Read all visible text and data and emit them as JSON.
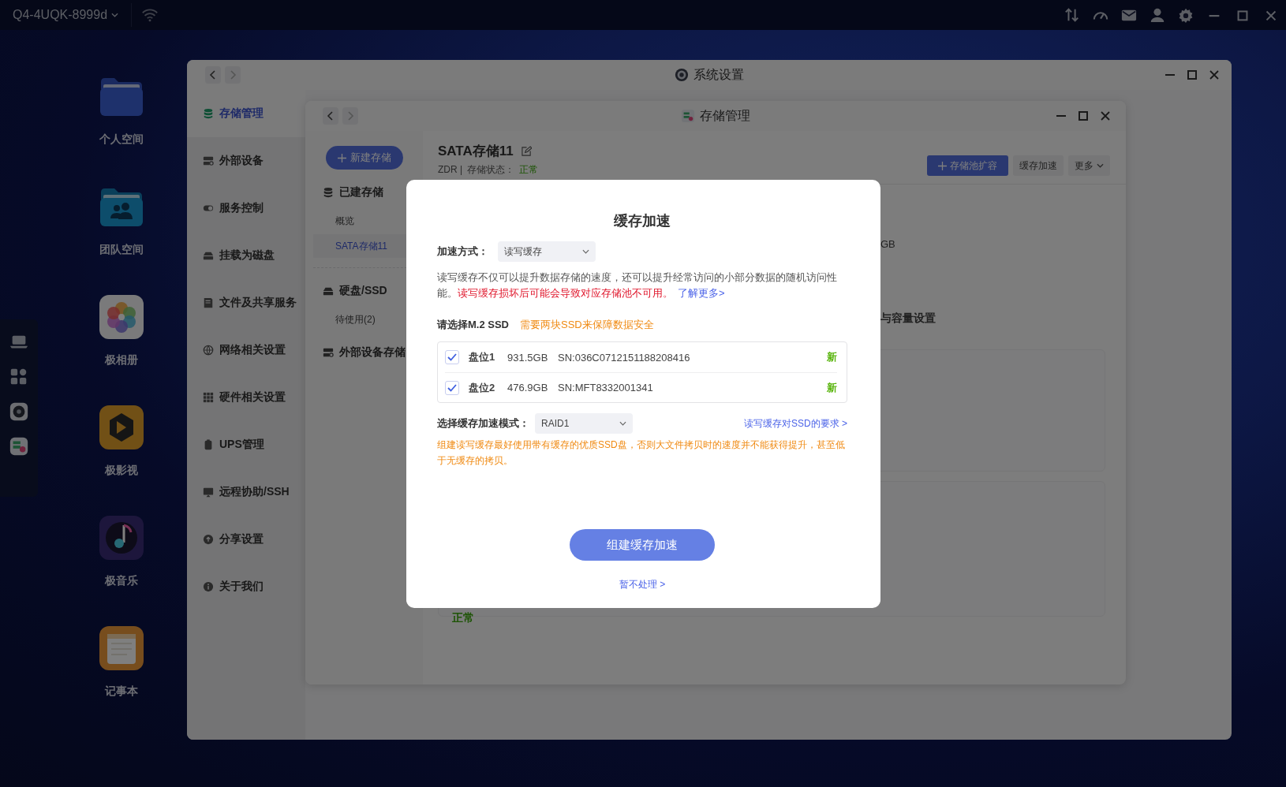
{
  "top_bar": {
    "device_name": "Q4-4UQK-8999d"
  },
  "desktop_icons": [
    {
      "label": "个人空间"
    },
    {
      "label": "团队空间"
    },
    {
      "label": "极相册"
    },
    {
      "label": "极影视"
    },
    {
      "label": "极音乐"
    },
    {
      "label": "记事本"
    }
  ],
  "settings_window": {
    "title": "系统设置",
    "sidebar": [
      {
        "label": "存储管理",
        "selected": true
      },
      {
        "label": "外部设备",
        "selected": false
      },
      {
        "label": "服务控制",
        "selected": false
      },
      {
        "label": "挂载为磁盘",
        "selected": false
      },
      {
        "label": "文件及共享服务",
        "selected": false
      },
      {
        "label": "网络相关设置",
        "selected": false
      },
      {
        "label": "硬件相关设置",
        "selected": false
      },
      {
        "label": "UPS管理",
        "selected": false
      },
      {
        "label": "远程协助/SSH",
        "selected": false
      },
      {
        "label": "分享设置",
        "selected": false
      },
      {
        "label": "关于我们",
        "selected": false
      }
    ]
  },
  "storage_window": {
    "title": "存储管理",
    "new_button": "新建存储",
    "nav": [
      {
        "label": "已建存储",
        "items": [
          {
            "label": "概览",
            "selected": false
          },
          {
            "label": "SATA存储11",
            "selected": true
          }
        ]
      },
      {
        "label": "硬盘/SSD",
        "items": [
          {
            "label": "待使用(2)",
            "selected": false
          }
        ]
      },
      {
        "label": "外部设备存储"
      }
    ],
    "pool": {
      "name": "SATA存储11",
      "type": "ZDR |",
      "status_label": "存储状态：",
      "status": "正常"
    },
    "actions": [
      "存储池扩容",
      "缓存加速",
      "更多"
    ],
    "fragments": [
      "GB",
      "与容量设置"
    ],
    "card_status": "正常"
  },
  "modal": {
    "title": "缓存加速",
    "mode_label": "加速方式：",
    "mode_value": "读写缓存",
    "description": "读写缓存不仅可以提升数据存储的速度，还可以提升经常访问的小部分数据的随机访问性能。",
    "warning": "读写缓存损坏后可能会导致对应存储池不可用。",
    "learn_more": "了解更多>",
    "ssd_heading": "请选择M.2 SSD",
    "ssd_note": "需要两块SSD来保障数据安全",
    "disks": [
      {
        "slot": "盘位1",
        "size": "931.5GB",
        "serial": "SN:036C0712151188208416",
        "badge": "新",
        "checked": true
      },
      {
        "slot": "盘位2",
        "size": "476.9GB",
        "serial": "SN:MFT8332001341",
        "badge": "新",
        "checked": true
      }
    ],
    "raid_label": "选择缓存加速模式：",
    "raid_value": "RAID1",
    "requirements_link": "读写缓存对SSD的要求 >",
    "advice": "组建读写缓存最好使用带有缓存的优质SSD盘，否则大文件拷贝时的速度并不能获得提升，甚至低于无缓存的拷贝。",
    "confirm_button": "组建缓存加速",
    "skip_link": "暂不处理 >"
  }
}
